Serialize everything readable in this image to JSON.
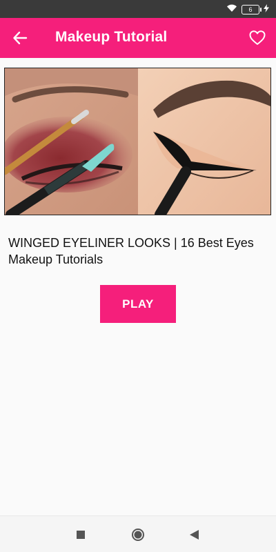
{
  "status_bar": {
    "battery_level": "6"
  },
  "app_bar": {
    "title": "Makeup Tutorial",
    "back_icon": "arrow-left-icon",
    "favorite_icon": "heart-outline-icon"
  },
  "video": {
    "title": "WINGED EYELINER LOOKS | 16 Best Eyes Makeup Tutorials",
    "play_label": "PLAY"
  },
  "nav_bar": {
    "recents_icon": "square-icon",
    "home_icon": "circle-icon",
    "back_icon": "triangle-back-icon"
  },
  "colors": {
    "accent": "#f51f7b",
    "status_bar": "#3a3a3a",
    "background": "#fafafa"
  }
}
